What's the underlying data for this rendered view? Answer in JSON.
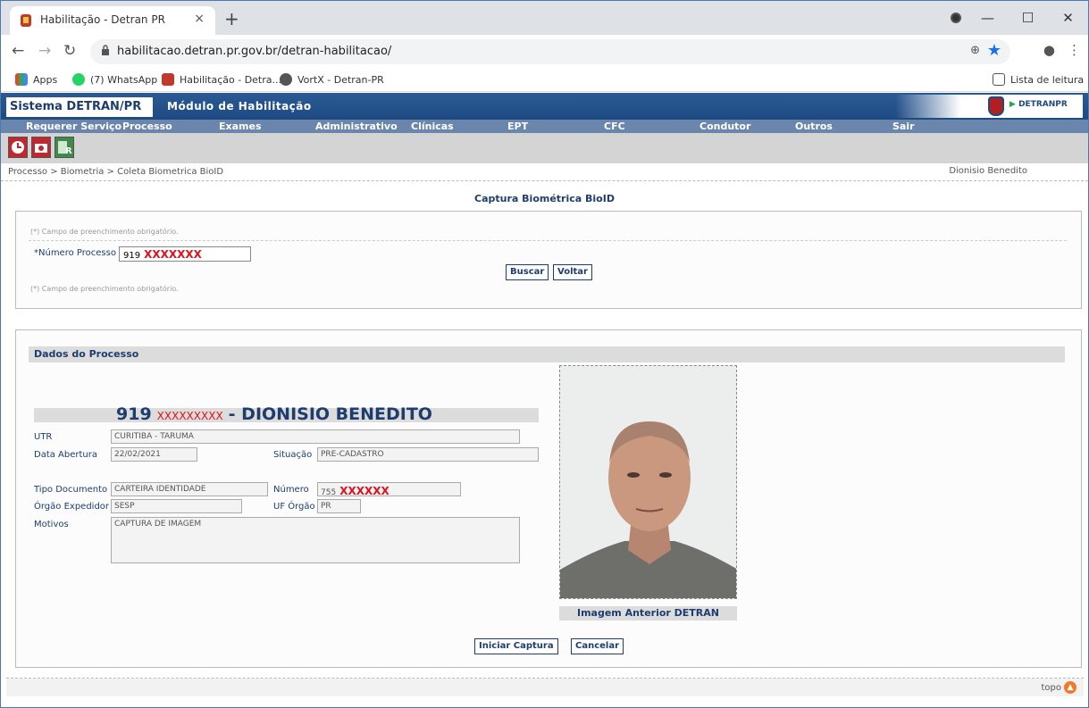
{
  "browser": {
    "tab_title": "Habilitação - Detran PR",
    "tab_close": "×",
    "new_tab": "+",
    "url": "habilitacao.detran.pr.gov.br/detran-habilitacao/",
    "bookmarks": [
      "Apps",
      "(7) WhatsApp",
      "Habilitação - Detra...",
      "VortX - Detran-PR"
    ],
    "reading_list": "Lista de leitura"
  },
  "site": {
    "system_name": "Sistema DETRAN/PR",
    "module_title": "Módulo de Habilitação",
    "logo_text": "DETRANPR",
    "menu": [
      "Requerer Serviço",
      "Processo",
      "Exames",
      "Administrativo",
      "Clínicas",
      "EPT",
      "CFC",
      "Condutor",
      "Outros",
      "Sair"
    ],
    "breadcrumb": "Processo > Biometria > Coleta Biometrica BioID",
    "user_name": "Dionisio Benedito"
  },
  "page": {
    "heading": "Captura Biométrica BioID",
    "required_note": "(*) Campo de preenchimento obrigatório.",
    "process_label": "*Número Processo",
    "process_value_prefix": "919",
    "process_value_masked": "XXXXXXX",
    "search_button": "Buscar",
    "back_button": "Voltar"
  },
  "process": {
    "section_title": "Dados do Processo",
    "title_number": "919",
    "title_masked": "XXXXXXXXX",
    "title_name": "- DIONISIO BENEDITO",
    "utr_label": "UTR",
    "utr_value": "CURITIBA - TARUMA",
    "opening_date_label": "Data Abertura",
    "opening_date_value": "22/02/2021",
    "status_label": "Situação",
    "status_value": "PRE-CADASTRO",
    "doc_type_label": "Tipo Documento",
    "doc_type_value": "CARTEIRA IDENTIDADE",
    "doc_number_label": "Número",
    "doc_number_prefix": "755",
    "doc_number_masked": "XXXXXX",
    "issuer_label": "Órgão Expedidor",
    "issuer_value": "SESP",
    "issuer_uf_label": "UF Órgão",
    "issuer_uf_value": "PR",
    "reasons_label": "Motivos",
    "reasons_value": "CAPTURA DE IMAGEM",
    "photo_caption": "Imagem Anterior DETRAN",
    "start_capture_button": "Iniciar Captura",
    "cancel_button": "Cancelar"
  },
  "footer": {
    "top_link": "topo"
  }
}
